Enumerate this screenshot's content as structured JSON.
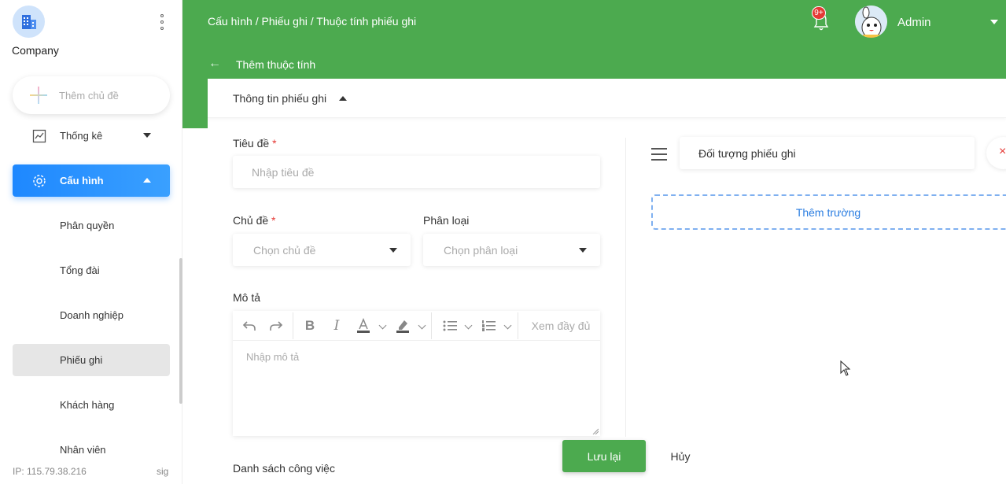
{
  "sidebar": {
    "company_name": "Company",
    "add_topic_label": "Thêm chủ đề",
    "items": [
      {
        "label": "Thống kê",
        "icon": "chart-icon"
      },
      {
        "label": "Cấu hình",
        "icon": "gear-icon"
      }
    ],
    "sub_items": [
      "Phân quyền",
      "Tổng đài",
      "Doanh nghiệp",
      "Phiếu ghi",
      "Khách hàng",
      "Nhân viên"
    ],
    "ip_text": "IP: 115.79.38.216",
    "sig_text": "sig"
  },
  "header": {
    "breadcrumb": "Cấu hình / Phiếu ghi / Thuộc tính phiếu ghi",
    "notification_badge": "9+",
    "user_name": "Admin",
    "page_subtitle": "Thêm thuộc tính"
  },
  "form": {
    "section_title": "Thông tin phiếu ghi",
    "title_label": "Tiêu đề",
    "title_placeholder": "Nhập tiêu đề",
    "topic_label": "Chủ đề",
    "topic_placeholder": "Chọn chủ đề",
    "category_label": "Phân loại",
    "category_placeholder": "Chọn phân loại",
    "description_label": "Mô tả",
    "description_placeholder": "Nhập mô tả",
    "editor_fullview": "Xem đầy đủ",
    "task_list_label": "Danh sách công việc",
    "required_mark": "*"
  },
  "right_panel": {
    "object_field": "Đối tượng phiếu ghi",
    "close_symbol": "×",
    "add_field_label": "Thêm trường"
  },
  "actions": {
    "save_label": "Lưu lại",
    "cancel_label": "Hủy"
  },
  "colors": {
    "brand_green": "#4caa4f",
    "active_blue": "#1e88ff",
    "danger_red": "#e53935",
    "link_blue": "#2a7de1"
  }
}
